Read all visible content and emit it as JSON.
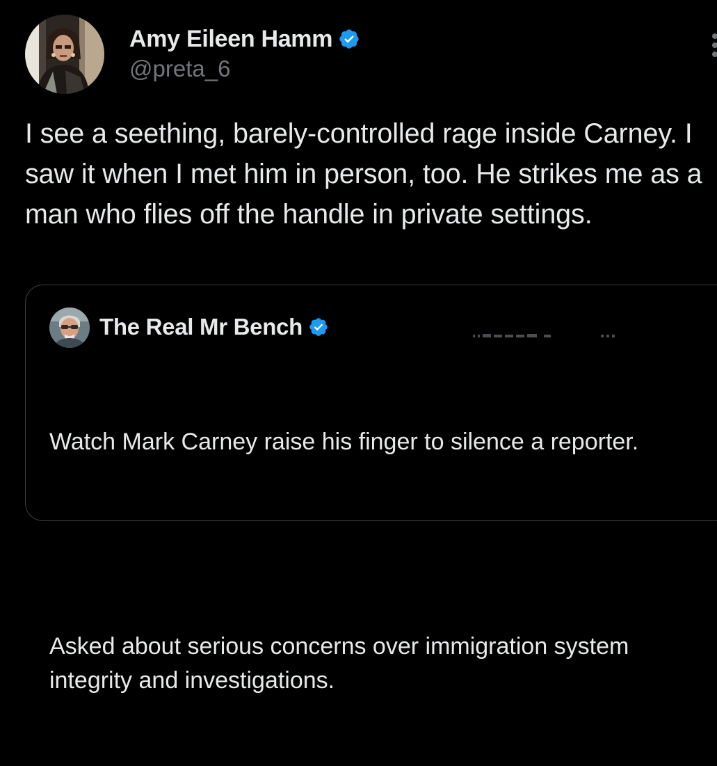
{
  "tweet": {
    "author": {
      "name": "Amy Eileen Hamm",
      "handle": "@preta_6",
      "verified": true,
      "avatar_icon": "profile-photo"
    },
    "text": "I see a seething, barely-controlled rage inside Carney. I saw it when I met him in person, too. He strikes me as a man who flies off the handle in private settings.",
    "more_icon": "more-vertical-icon"
  },
  "quote": {
    "author": {
      "name": "The Real Mr Bench",
      "verified": true,
      "avatar_icon": "profile-photo"
    },
    "paragraphs": [
      "Watch Mark Carney raise his finger to silence a reporter.",
      "Asked about serious concerns over immigration system integrity and investigations."
    ]
  },
  "colors": {
    "background": "#000000",
    "primary_text": "#e7e9ea",
    "secondary_text": "#71767b",
    "verified_badge": "#1d9bf0",
    "card_border": "#3a3d41"
  }
}
